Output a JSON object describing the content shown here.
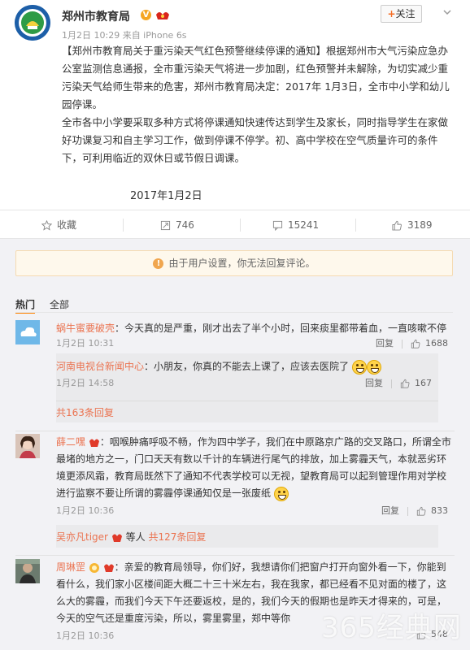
{
  "post": {
    "author": "郑州市教育局",
    "meta": "1月2日 10:29 来自 iPhone 6s",
    "follow_label": "关注",
    "follow_plus": "+",
    "body_p1": "【郑州市教育局关于重污染天气红色预警继续停课的通知】根据郑州市大气污染应急办公室监测信息通报，全市重污染天气将进一步加剧，红色预警并未解除，为切实减少重污染天气给师生带来的危害，郑州市教育局决定：2017年 1月3日，全市中小学和幼儿园停课。",
    "body_p2": "全市各中小学要采取多种方式将停课通知快速传达到学生及家长，同时指导学生在家做好功课复习和自主学习工作，做到停课不停学。初、高中学校在空气质量许可的条件下，可利用临近的双休日或节假日调课。",
    "date": "2017年1月2日"
  },
  "actions": {
    "favorite": "收藏",
    "repost": "746",
    "comment": "15241",
    "like": "3189"
  },
  "notice": "由于用户设置，你无法回复评论。",
  "tabs": {
    "hot": "热门",
    "all": "全部"
  },
  "comments": [
    {
      "user": "蜗牛蜜要破壳",
      "text": "：今天真的是严重，刚才出去了半个小时，回来痰里都带着血，一直咳嗽不停",
      "time": "1月2日 10:31",
      "reply_label": "回复",
      "likes": "1688",
      "reply": {
        "user": "河南电视台新闻中心",
        "text": "：小朋友，你真的不能去上课了，应该去医院了",
        "time": "1月2日 14:58",
        "reply_label": "回复",
        "likes": "167"
      },
      "more": "共163条回复"
    },
    {
      "user": "薛二嘿",
      "text": "：咽喉肿痛呼吸不畅，作为四中学子，我们在中原路京广路的交叉路口，所谓全市最堵的地方之一，门口天天有数以千计的车辆进行尾气的排放，加上雾霾天气，本就恶劣环境更添风霜，教育局既然下了通知不代表学校可以无视，望教育局可以起到管理作用对学校进行监察不要让所谓的雾霾停课通知仅是一张废纸",
      "time": "1月2日 10:36",
      "reply_label": "回复",
      "likes": "833",
      "sub_user": "吴亦凡tiger",
      "sub_mid": "等人",
      "sub_more": "共127条回复"
    },
    {
      "user": "周琳罡",
      "text": "：亲爱的教育局领导，你们好，我想请你们把窗户打开向窗外看一下，你能到看什么，我们家小区楼间距大概二十三十米左右，我在我家，都已经看不见对面的楼了，这么大的雾霾，而我们今天下午还要返校，是的，我们今天的假期也是昨天才得来的，可是，今天的空气还是重度污染，所以，雾里雾里，郑中等你",
      "time": "1月2日 10:36",
      "likes": "548"
    }
  ],
  "watermark": "365经典网"
}
